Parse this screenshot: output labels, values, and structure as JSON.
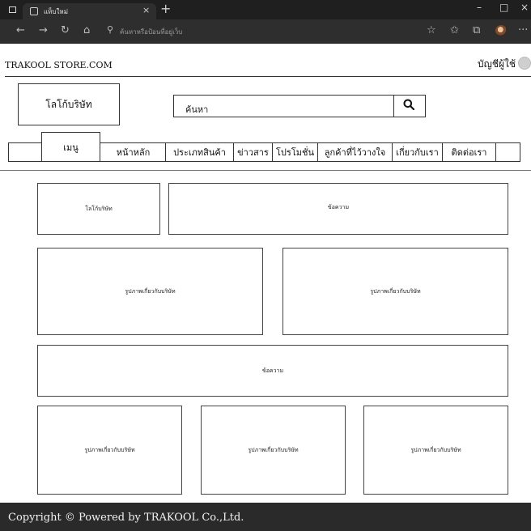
{
  "browser": {
    "tab_title": "แท็บใหม่",
    "tab_close": "×",
    "new_tab": "+",
    "minimize": "–",
    "maximize": "□",
    "close": "×",
    "address_placeholder": "ค้นหาหรือป้อนที่อยู่เว็บ",
    "icons": [
      "back-icon",
      "forward-icon",
      "refresh-icon",
      "home-icon",
      "search-icon",
      "favorites-icon",
      "collections-icon",
      "extensions-icon",
      "profile-icon",
      "more-icon"
    ]
  },
  "header": {
    "site_name": "TRAKOOL STORE.COM",
    "account": "บัญชีผู้ใช้"
  },
  "logo_box": "โลโก้บริษัท",
  "search": {
    "text": "ค้นหา"
  },
  "nav": {
    "menu": "เมนู",
    "items": [
      "หน้าหลัก",
      "ประเภทสินค้า",
      "ข่าวสาร",
      "โปรโมชั่น",
      "ลูกค้าที่ไว้วางใจ",
      "เกี่ยวกับเรา",
      "ติดต่อเรา"
    ]
  },
  "content": {
    "row1": {
      "logo": "โลโก้บริษัท",
      "text": "ข้อความ"
    },
    "row2": [
      "รูปภาพเกี่ยวกับบริษัท",
      "รูปภาพเกี่ยวกับบริษัท"
    ],
    "row3": "ข้อความ",
    "row4": [
      "รูปภาพเกี่ยวกับบริษัท",
      "รูปภาพเกี่ยวกับบริษัท",
      "รูปภาพเกี่ยวกับบริษัท"
    ]
  },
  "footer": {
    "text": "Copyright © Powered by TRAKOOL Co.,Ltd."
  }
}
